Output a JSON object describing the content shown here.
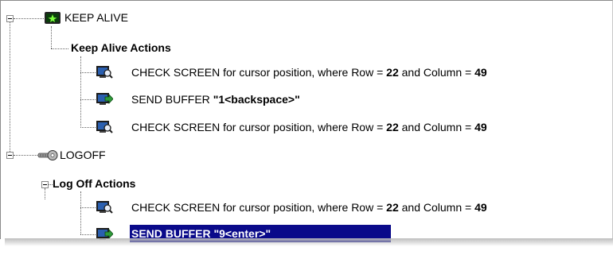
{
  "tree": {
    "keep_alive": {
      "label": "KEEP ALIVE",
      "icon": "keep-alive-icon",
      "group_label": "Keep Alive Actions",
      "actions": [
        {
          "type": "check",
          "text": "CHECK SCREEN for cursor position, where Row = ",
          "row": "22",
          "mid": " and Column = ",
          "col": "49"
        },
        {
          "type": "send",
          "text": "SEND BUFFER ",
          "value": "\"1<backspace>\""
        },
        {
          "type": "check",
          "text": "CHECK SCREEN for cursor position, where Row = ",
          "row": "22",
          "mid": " and Column = ",
          "col": "49"
        }
      ]
    },
    "logoff": {
      "label": "LOGOFF",
      "icon": "key-icon",
      "group_label": "Log Off Actions",
      "actions": [
        {
          "type": "check",
          "text": "CHECK SCREEN for cursor position, where Row = ",
          "row": "22",
          "mid": " and Column = ",
          "col": "49"
        },
        {
          "type": "send",
          "text": "SEND BUFFER \"9<enter>\"",
          "selected": true
        }
      ]
    }
  },
  "colors": {
    "selection": "#0a0a8a",
    "check_icon_blue": "#2a5fb0",
    "send_icon_green": "#2e9a3a"
  }
}
